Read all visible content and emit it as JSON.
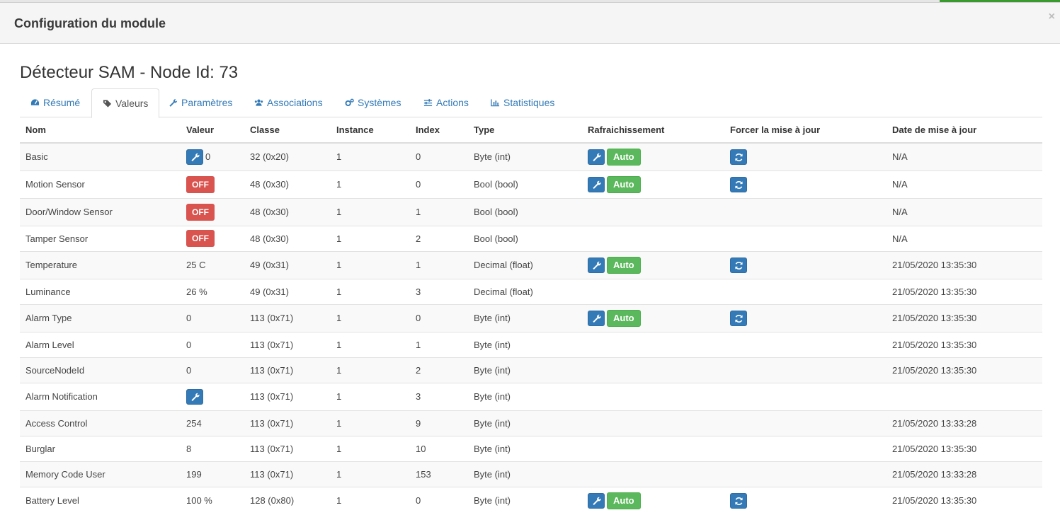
{
  "modal": {
    "title": "Configuration du module",
    "close": "×"
  },
  "heading": "Détecteur SAM - Node Id: 73",
  "tabs": [
    {
      "label": "Résumé",
      "icon": "dashboard-icon"
    },
    {
      "label": "Valeurs",
      "icon": "tag-icon"
    },
    {
      "label": "Paramètres",
      "icon": "wrench-icon"
    },
    {
      "label": "Associations",
      "icon": "users-icon"
    },
    {
      "label": "Systèmes",
      "icon": "cogs-icon"
    },
    {
      "label": "Actions",
      "icon": "sliders-icon"
    },
    {
      "label": "Statistiques",
      "icon": "bar-chart-icon"
    }
  ],
  "table": {
    "headers": [
      "Nom",
      "Valeur",
      "Classe",
      "Instance",
      "Index",
      "Type",
      "Rafraichissement",
      "Forcer la mise à jour",
      "Date de mise à jour"
    ],
    "auto_label": "Auto",
    "off_label": "OFF",
    "rows": [
      {
        "nom": "Basic",
        "valeur": "0",
        "classe": "32 (0x20)",
        "instance": "1",
        "index": "0",
        "type": "Byte (int)",
        "date": "N/A"
      },
      {
        "nom": "Motion Sensor",
        "valeur": "",
        "classe": "48 (0x30)",
        "instance": "1",
        "index": "0",
        "type": "Bool (bool)",
        "date": "N/A"
      },
      {
        "nom": "Door/Window Sensor",
        "valeur": "",
        "classe": "48 (0x30)",
        "instance": "1",
        "index": "1",
        "type": "Bool (bool)",
        "date": "N/A"
      },
      {
        "nom": "Tamper Sensor",
        "valeur": "",
        "classe": "48 (0x30)",
        "instance": "1",
        "index": "2",
        "type": "Bool (bool)",
        "date": "N/A"
      },
      {
        "nom": "Temperature",
        "valeur": "25 C",
        "classe": "49 (0x31)",
        "instance": "1",
        "index": "1",
        "type": "Decimal (float)",
        "date": "21/05/2020 13:35:30"
      },
      {
        "nom": "Luminance",
        "valeur": "26 %",
        "classe": "49 (0x31)",
        "instance": "1",
        "index": "3",
        "type": "Decimal (float)",
        "date": "21/05/2020 13:35:30"
      },
      {
        "nom": "Alarm Type",
        "valeur": "0",
        "classe": "113 (0x71)",
        "instance": "1",
        "index": "0",
        "type": "Byte (int)",
        "date": "21/05/2020 13:35:30"
      },
      {
        "nom": "Alarm Level",
        "valeur": "0",
        "classe": "113 (0x71)",
        "instance": "1",
        "index": "1",
        "type": "Byte (int)",
        "date": "21/05/2020 13:35:30"
      },
      {
        "nom": "SourceNodeId",
        "valeur": "0",
        "classe": "113 (0x71)",
        "instance": "1",
        "index": "2",
        "type": "Byte (int)",
        "date": "21/05/2020 13:35:30"
      },
      {
        "nom": "Alarm Notification",
        "valeur": "",
        "classe": "113 (0x71)",
        "instance": "1",
        "index": "3",
        "type": "Byte (int)",
        "date": ""
      },
      {
        "nom": "Access Control",
        "valeur": "254",
        "classe": "113 (0x71)",
        "instance": "1",
        "index": "9",
        "type": "Byte (int)",
        "date": "21/05/2020 13:33:28"
      },
      {
        "nom": "Burglar",
        "valeur": "8",
        "classe": "113 (0x71)",
        "instance": "1",
        "index": "10",
        "type": "Byte (int)",
        "date": "21/05/2020 13:35:30"
      },
      {
        "nom": "Memory Code User",
        "valeur": "199",
        "classe": "113 (0x71)",
        "instance": "1",
        "index": "153",
        "type": "Byte (int)",
        "date": "21/05/2020 13:33:28"
      },
      {
        "nom": "Battery Level",
        "valeur": "100 %",
        "classe": "128 (0x80)",
        "instance": "1",
        "index": "0",
        "type": "Byte (int)",
        "date": "21/05/2020 13:35:30"
      }
    ]
  },
  "colors": {
    "primary": "#337ab7",
    "success": "#5cb85c",
    "danger": "#d9534f"
  }
}
